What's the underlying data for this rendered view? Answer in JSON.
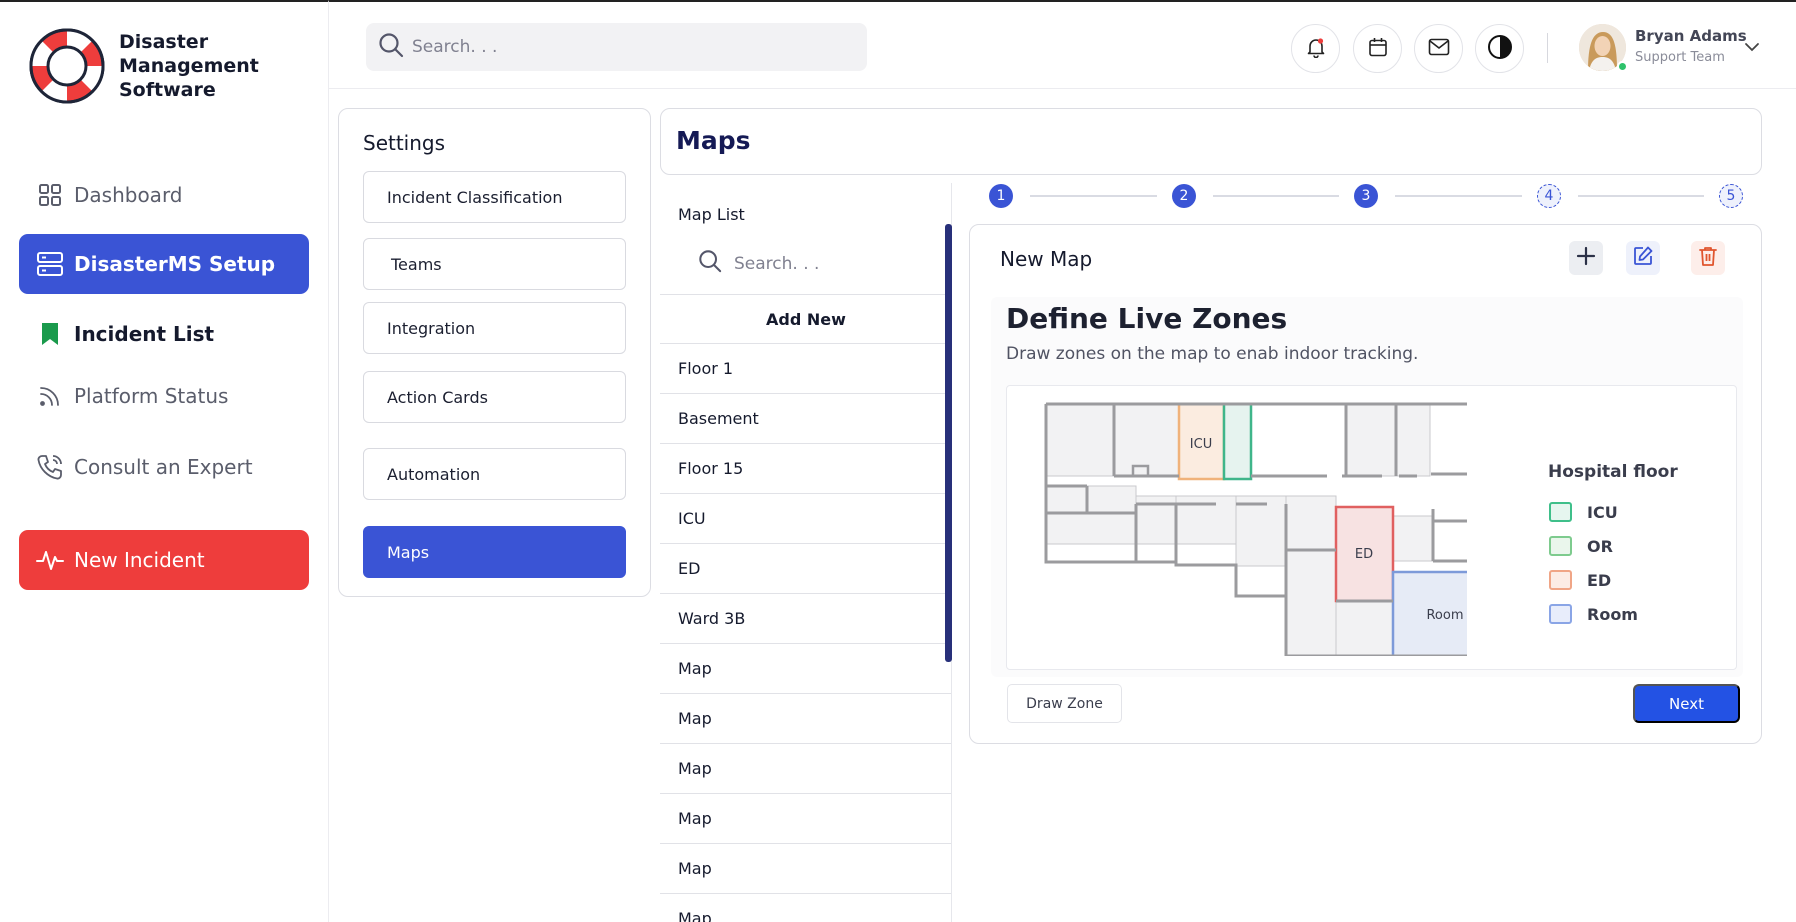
{
  "brand": {
    "name_line1": "Disaster",
    "name_line2": "Management",
    "name_line3": "Software"
  },
  "sidebar": {
    "items": [
      {
        "label": "Dashboard",
        "icon": "grid-icon"
      },
      {
        "label": "DisasterMS Setup",
        "icon": "server-icon"
      },
      {
        "label": "Incident List",
        "icon": "bookmark-icon"
      },
      {
        "label": "Platform Status",
        "icon": "signal-icon"
      },
      {
        "label": "Consult an Expert",
        "icon": "phone-icon"
      }
    ],
    "new_incident": "New Incident"
  },
  "header": {
    "search_placeholder": "Search. . .",
    "user": {
      "name": "Bryan Adams",
      "role": "Support Team"
    }
  },
  "settings": {
    "title": "Settings",
    "items": [
      "Incident Classification",
      "Teams",
      "Integration",
      "Action Cards",
      "Automation",
      "Maps"
    ]
  },
  "maps": {
    "title": "Maps",
    "list_title": "Map List",
    "search_placeholder": "Search. . .",
    "add_new": "Add New",
    "items": [
      "Floor 1",
      "Basement",
      "Floor 15",
      "ICU",
      "ED",
      "Ward 3B",
      "Map",
      "Map",
      "Map",
      "Map",
      "Map",
      "Map"
    ]
  },
  "stepper": {
    "steps": [
      "1",
      "2",
      "3",
      "4",
      "5"
    ],
    "current": 3
  },
  "new_map": {
    "title": "New Map",
    "heading": "Define Live Zones",
    "subtitle": "Draw zones on the map to enab indoor tracking.",
    "zones": {
      "icu": "ICU",
      "ed": "ED",
      "room": "Room"
    },
    "legend_title": "Hospital floor",
    "legend": [
      {
        "label": "ICU",
        "color": "#3fbf8a",
        "fill": "#e6f6ef"
      },
      {
        "label": "OR",
        "color": "#7ecb8e",
        "fill": "#eaf6ec"
      },
      {
        "label": "ED",
        "color": "#f0a586",
        "fill": "#fcece5"
      },
      {
        "label": "Room",
        "color": "#8aa5e6",
        "fill": "#e8edfb"
      }
    ],
    "draw_zone": "Draw Zone",
    "next": "Next"
  },
  "colors": {
    "primary": "#3a54d5",
    "danger": "#ee3d3c",
    "heading": "#151a55"
  }
}
